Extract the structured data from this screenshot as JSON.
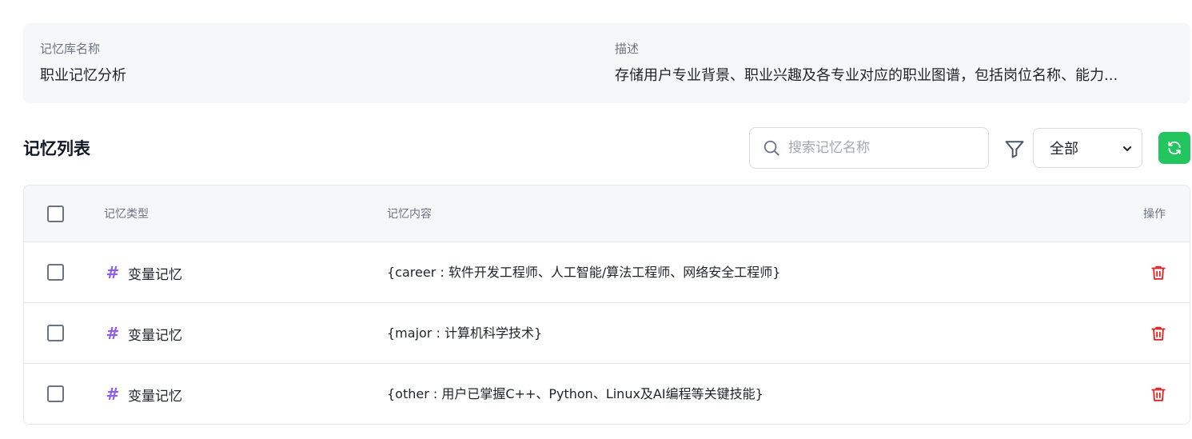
{
  "info": {
    "name_label": "记忆库名称",
    "name_value": "职业记忆分析",
    "desc_label": "描述",
    "desc_value": "存储用户专业背景、职业兴趣及各专业对应的职业图谱，包括岗位名称、能力..."
  },
  "list": {
    "title": "记忆列表",
    "search_placeholder": "搜索记忆名称",
    "filter_selected": "全部"
  },
  "table": {
    "headers": {
      "type": "记忆类型",
      "content": "记忆内容",
      "op": "操作"
    },
    "rows": [
      {
        "type": "变量记忆",
        "content": "{career : 软件开发工程师、人工智能/算法工程师、网络安全工程师}"
      },
      {
        "type": "变量记忆",
        "content": "{major : 计算机科学技术}"
      },
      {
        "type": "变量记忆",
        "content": "{other : 用户已掌握C++、Python、Linux及AI编程等关键技能}"
      }
    ]
  },
  "icons": {
    "search": "search-icon",
    "filter": "filter-icon",
    "dropdown": "chevron-down-icon",
    "refresh": "refresh-icon",
    "type": "hash-icon",
    "delete": "trash-icon"
  },
  "colors": {
    "accent_green": "#22c55e",
    "hash_purple": "#8b5cf6",
    "delete_red": "#dc2626"
  }
}
